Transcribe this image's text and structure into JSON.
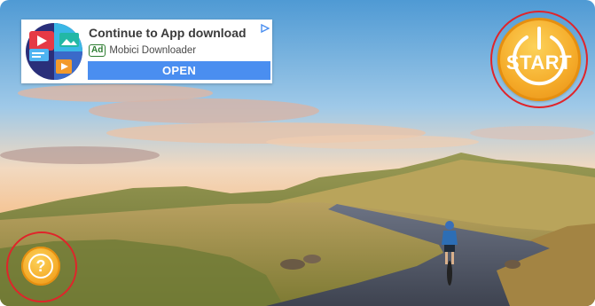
{
  "ad": {
    "title": "Continue to App download",
    "badge": "Ad",
    "advertiser": "Mobici Downloader",
    "cta": "OPEN"
  },
  "controls": {
    "start_label": "START",
    "help_label": "?"
  },
  "icons": {
    "ad_logo": "media-collage-icon",
    "ad_choices": "adchoices-icon",
    "start": "power-icon",
    "help": "question-icon"
  },
  "colors": {
    "accent_orange": "#f5ac2a",
    "highlight_ring": "#e0242a",
    "ad_cta_blue": "#4a8ef0"
  }
}
